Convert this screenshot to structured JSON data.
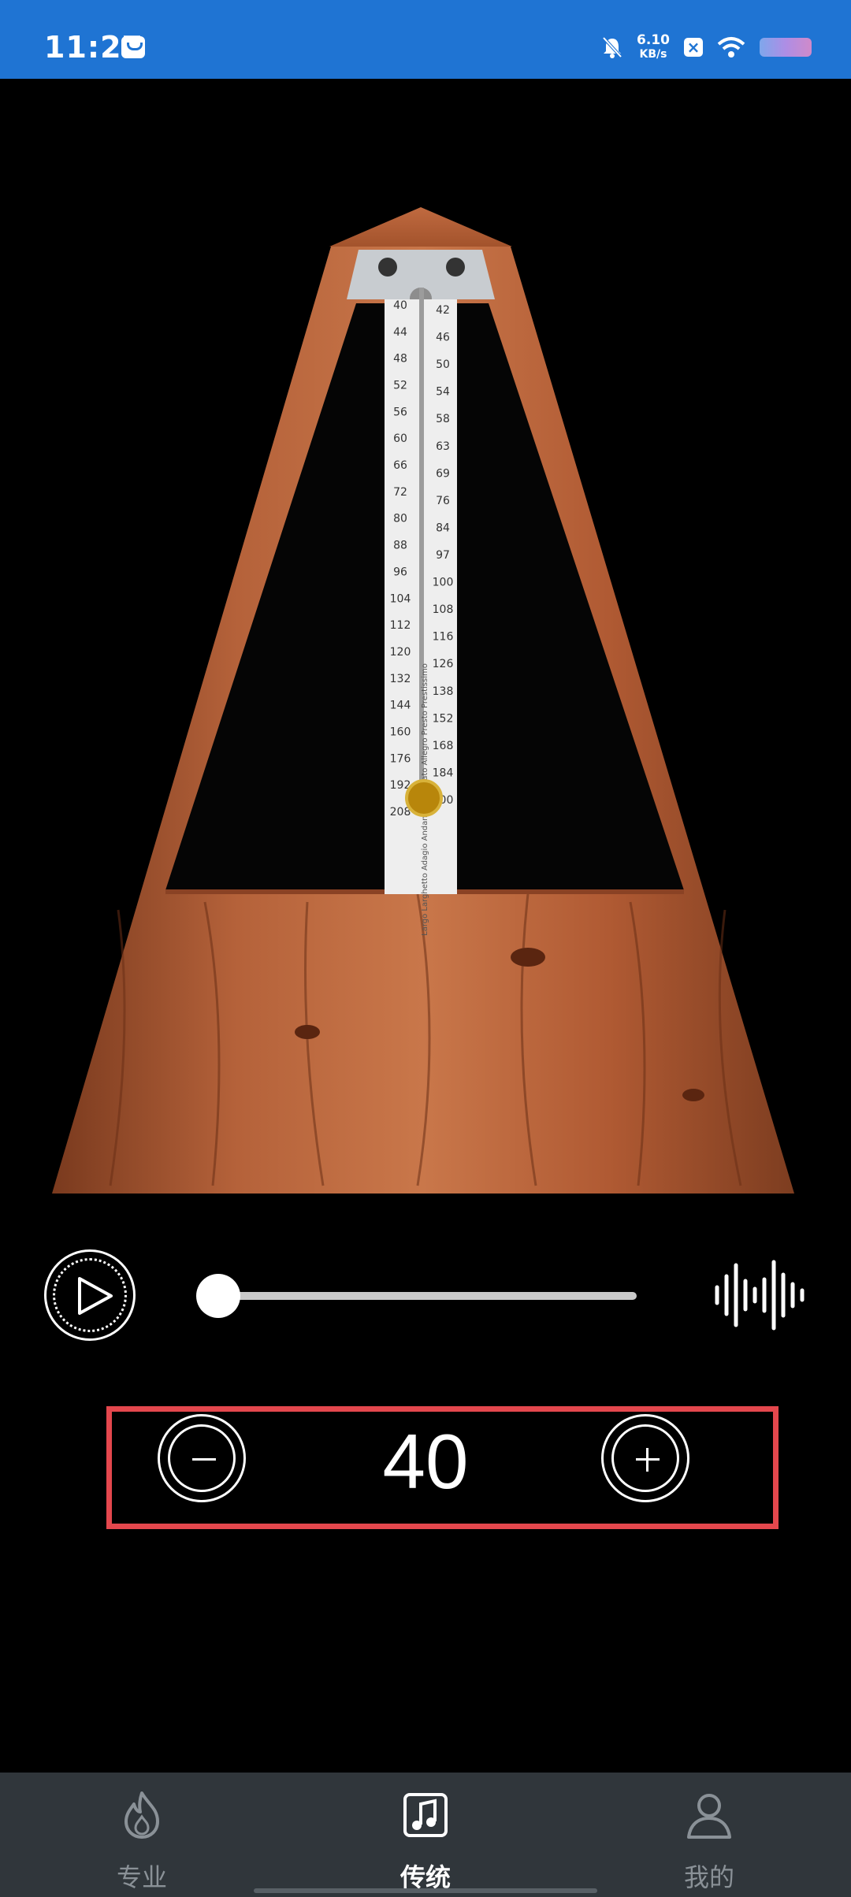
{
  "status_bar": {
    "time": "11:27",
    "net_speed_value": "6.10",
    "net_speed_unit": "KB/s",
    "notification_icons": [
      "mail-icon"
    ],
    "system_icons": [
      "bell-muted-icon",
      "sim-x-icon",
      "wifi-icon",
      "battery-icon"
    ]
  },
  "metronome": {
    "scale_left": [
      "40",
      "44",
      "48",
      "52",
      "56",
      "60",
      "66",
      "72",
      "80",
      "88",
      "96",
      "104",
      "112",
      "120",
      "132",
      "144",
      "160",
      "176",
      "192",
      "208"
    ],
    "scale_right": [
      "42",
      "46",
      "50",
      "54",
      "58",
      "63",
      "69",
      "76",
      "84",
      "97",
      "100",
      "108",
      "116",
      "126",
      "138",
      "152",
      "168",
      "184",
      "200"
    ],
    "mid_text": "Largo Larghetto Adagio Andante Moderato Allegro Presto Prestissimo"
  },
  "controls": {
    "play_icon": "play-icon",
    "tempo_slider_value": 0,
    "sound_icon": "sound-wave-icon"
  },
  "stepper": {
    "decrement_icon": "minus-icon",
    "bpm": "40",
    "increment_icon": "plus-icon"
  },
  "bottom_nav": {
    "active_index": 1,
    "items": [
      {
        "label": "专业",
        "icon": "flame-icon"
      },
      {
        "label": "传统",
        "icon": "music-note-icon"
      },
      {
        "label": "我的",
        "icon": "person-icon"
      }
    ]
  },
  "colors": {
    "status_bar": "#1f74d3",
    "highlight_box": "#e4474d",
    "nav_background": "#30363b",
    "wood": "#a0522d"
  }
}
